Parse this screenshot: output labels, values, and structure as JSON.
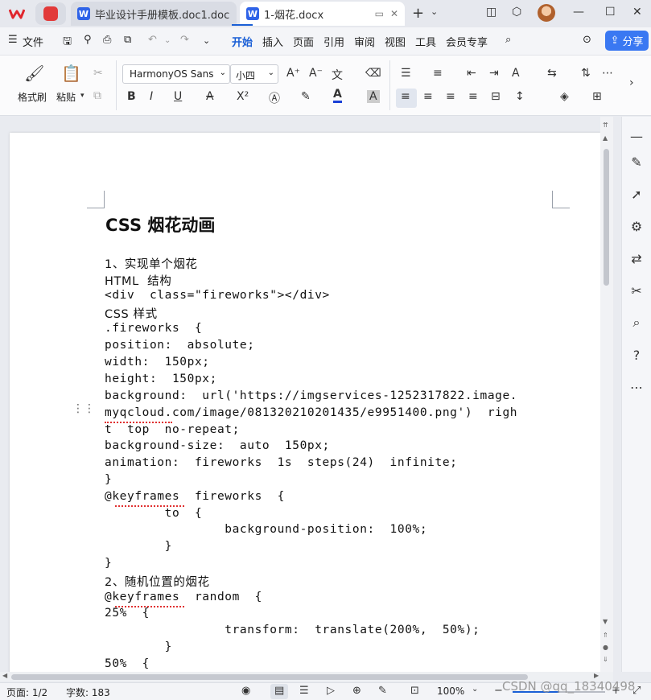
{
  "titlebar": {
    "tabs": [
      {
        "title": "毕业设计手册模板.doc1.doc",
        "badge": "W"
      },
      {
        "title": "1-烟花.docx",
        "badge": "W"
      }
    ]
  },
  "menu": {
    "file_label": "文件",
    "items": [
      "开始",
      "插入",
      "页面",
      "引用",
      "审阅",
      "视图",
      "工具",
      "会员专享"
    ],
    "share_label": "分享"
  },
  "ribbon": {
    "format_painter": "格式刷",
    "paste": "粘贴",
    "font_name": "HarmonyOS Sans",
    "font_size": "小四"
  },
  "document": {
    "title": "CSS 烟花动画",
    "lines": [
      "1、实现单个烟花",
      "HTML  结构",
      "<div  class=\"fireworks\"></div>",
      "CSS 样式",
      ".fireworks  {",
      "position:  absolute;",
      "width:  150px;",
      "height:  150px;",
      "background:  url('https://imgservices-1252317822.image.",
      "myqcloud.com/image/081320210201435/e9951400.png')  righ",
      "t  top  no-repeat;",
      "background-size:  auto  150px;",
      "animation:  fireworks  1s  steps(24)  infinite;",
      "}",
      "@keyframes  fireworks  {",
      "        to  {",
      "                background-position:  100%;",
      "        }",
      "}",
      "2、随机位置的烟花",
      "@keyframes  random  {",
      "25%  {",
      "                transform:  translate(200%,  50%);",
      "        }",
      "50%  {"
    ]
  },
  "status": {
    "page": "页面: 1/2",
    "words": "字数: 183",
    "zoom": "100%",
    "zoom_fraction": 0.5
  },
  "watermark": "CSDN @qq_18340498"
}
